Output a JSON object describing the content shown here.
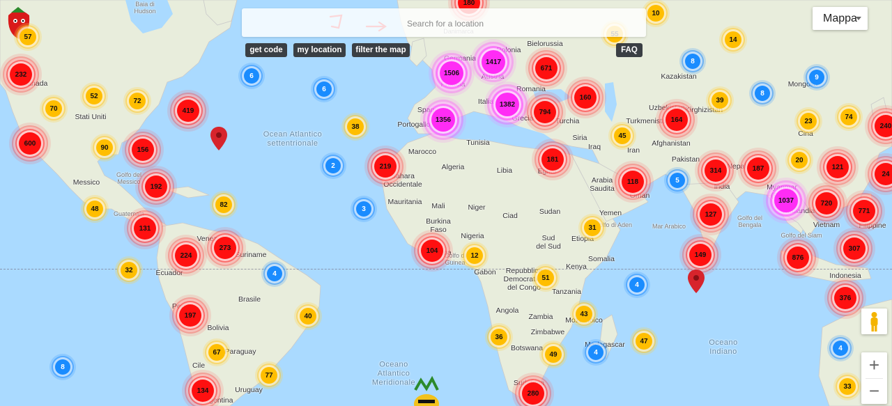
{
  "map": {
    "search_placeholder": "Search for a location",
    "map_type": "Mappa",
    "buttons": {
      "get_code": "get code",
      "my_location": "my location",
      "filter_map": "filter the map",
      "faq": "FAQ"
    },
    "labels": [
      {
        "id": "hudson",
        "text": "Baia di\nHudson",
        "cls": "faint"
      },
      {
        "id": "canada",
        "text": "Canada"
      },
      {
        "id": "stati-uniti",
        "text": "Stati Uniti"
      },
      {
        "id": "messico",
        "text": "Messico"
      },
      {
        "id": "golfo-messico",
        "text": "Golfo del\nMessico",
        "cls": "faint"
      },
      {
        "id": "guatemala",
        "text": "Guatemala",
        "cls": "faint"
      },
      {
        "id": "venezuela",
        "text": "Venezuela"
      },
      {
        "id": "suriname",
        "text": "Suriname"
      },
      {
        "id": "ecuador",
        "text": "Ecuador"
      },
      {
        "id": "peru",
        "text": "Perù"
      },
      {
        "id": "brasile",
        "text": "Brasile"
      },
      {
        "id": "bolivia",
        "text": "Bolivia"
      },
      {
        "id": "paraguay",
        "text": "Paraguay"
      },
      {
        "id": "cile",
        "text": "Cile"
      },
      {
        "id": "uruguay",
        "text": "Uruguay"
      },
      {
        "id": "argentina",
        "text": "Argentina"
      },
      {
        "id": "atlantic",
        "text": "Ocean Atlantico\nsettentrionale",
        "cls": "ocean"
      },
      {
        "id": "oceano-atlantico",
        "text": "Oceano\nAtlantico\nMeridionale",
        "cls": "ocean"
      },
      {
        "id": "oceano-indiano",
        "text": "Oceano\nIndiano",
        "cls": "ocean"
      },
      {
        "id": "danimarca",
        "text": "Danimarca",
        "cls": "faint"
      },
      {
        "id": "germania",
        "text": "Germania"
      },
      {
        "id": "polonia",
        "text": "Polonia"
      },
      {
        "id": "bielorussia",
        "text": "Bielorussia"
      },
      {
        "id": "austria",
        "text": "Austria"
      },
      {
        "id": "francia",
        "text": "Francia"
      },
      {
        "id": "romania",
        "text": "Romania"
      },
      {
        "id": "italia",
        "text": "Italia"
      },
      {
        "id": "spagna",
        "text": "Spagna"
      },
      {
        "id": "portogallo",
        "text": "Portogallo"
      },
      {
        "id": "grecia",
        "text": "Grecia"
      },
      {
        "id": "turchia",
        "text": "Turchia"
      },
      {
        "id": "kazakistan",
        "text": "Kazakistan"
      },
      {
        "id": "mongolia",
        "text": "Mongolia"
      },
      {
        "id": "uzbekistan",
        "text": "Uzbekistan"
      },
      {
        "id": "kirghizistan",
        "text": "Kirghizistan"
      },
      {
        "id": "turkmenistan",
        "text": "Turkmenistan"
      },
      {
        "id": "cina",
        "text": "Cina"
      },
      {
        "id": "siria",
        "text": "Siria"
      },
      {
        "id": "iraq",
        "text": "Iraq"
      },
      {
        "id": "iran",
        "text": "Iran"
      },
      {
        "id": "afghanistan",
        "text": "Afghanistan"
      },
      {
        "id": "pakistan",
        "text": "Pakistan"
      },
      {
        "id": "nepal",
        "text": "Nepal"
      },
      {
        "id": "india",
        "text": "India"
      },
      {
        "id": "marocco",
        "text": "Marocco"
      },
      {
        "id": "tunisia",
        "text": "Tunisia"
      },
      {
        "id": "algeria",
        "text": "Algeria"
      },
      {
        "id": "libia",
        "text": "Libia"
      },
      {
        "id": "egitto",
        "text": "Egitto"
      },
      {
        "id": "arabia",
        "text": "Arabia\nSaudita"
      },
      {
        "id": "oman",
        "text": "Oman"
      },
      {
        "id": "yemen",
        "text": "Yemen"
      },
      {
        "id": "sahara",
        "text": "Sahara\nOccidentale"
      },
      {
        "id": "mauritania",
        "text": "Mauritania"
      },
      {
        "id": "mali",
        "text": "Mali"
      },
      {
        "id": "niger",
        "text": "Niger"
      },
      {
        "id": "ciad",
        "text": "Ciad"
      },
      {
        "id": "sudan",
        "text": "Sudan"
      },
      {
        "id": "burkina",
        "text": "Burkina\nFaso"
      },
      {
        "id": "nigeria",
        "text": "Nigeria"
      },
      {
        "id": "sud-sudan",
        "text": "Sud\ndel Sud"
      },
      {
        "id": "etiopia",
        "text": "Etiopia"
      },
      {
        "id": "somalia",
        "text": "Somalia"
      },
      {
        "id": "kenya",
        "text": "Kenya"
      },
      {
        "id": "ghana",
        "text": "Ghana"
      },
      {
        "id": "golfo-guinea",
        "text": "Golfo di\nGuinea",
        "cls": "faint"
      },
      {
        "id": "gabon",
        "text": "Gabon"
      },
      {
        "id": "congo",
        "text": "Repubblica\nDemocratica\ndel Congo"
      },
      {
        "id": "tanzania",
        "text": "Tanzania"
      },
      {
        "id": "angola",
        "text": "Angola"
      },
      {
        "id": "zambia",
        "text": "Zambia"
      },
      {
        "id": "zimbabwe",
        "text": "Zimbabwe"
      },
      {
        "id": "mozambico",
        "text": "Mozambico"
      },
      {
        "id": "botswana",
        "text": "Botswana"
      },
      {
        "id": "madagascar",
        "text": "Madagascar"
      },
      {
        "id": "sudafrica",
        "text": "Sudafrica"
      },
      {
        "id": "golfo-aden",
        "text": "Golfo di Aden",
        "cls": "faint"
      },
      {
        "id": "mar-arabico",
        "text": "Mar Arabico",
        "cls": "faint"
      },
      {
        "id": "golfo-bengala",
        "text": "Golfo del\nBengala",
        "cls": "faint"
      },
      {
        "id": "golfo-siam",
        "text": "Golfo del Siam",
        "cls": "faint"
      },
      {
        "id": "myanmar",
        "text": "Myanmar\n(Birm.)"
      },
      {
        "id": "thailandia",
        "text": "Thailandia"
      },
      {
        "id": "vietnam",
        "text": "Vietnam"
      },
      {
        "id": "filippine",
        "text": "Filippine"
      },
      {
        "id": "indonesia",
        "text": "Indonesia"
      }
    ],
    "clusters": [
      {
        "v": "57",
        "c": "yel"
      },
      {
        "v": "232",
        "c": "red"
      },
      {
        "v": "52",
        "c": "yel"
      },
      {
        "v": "72",
        "c": "yel"
      },
      {
        "v": "70",
        "c": "yel"
      },
      {
        "v": "419",
        "c": "red"
      },
      {
        "v": "6",
        "c": "blu"
      },
      {
        "v": "6",
        "c": "blu"
      },
      {
        "v": "600",
        "c": "red"
      },
      {
        "v": "90",
        "c": "yel"
      },
      {
        "v": "156",
        "c": "red"
      },
      {
        "v": "38",
        "c": "yel"
      },
      {
        "v": "2",
        "c": "blu"
      },
      {
        "v": "192",
        "c": "red"
      },
      {
        "v": "48",
        "c": "yel"
      },
      {
        "v": "82",
        "c": "yel"
      },
      {
        "v": "219",
        "c": "red"
      },
      {
        "v": "3",
        "c": "blu"
      },
      {
        "v": "131",
        "c": "red"
      },
      {
        "v": "224",
        "c": "red"
      },
      {
        "v": "273",
        "c": "red"
      },
      {
        "v": "32",
        "c": "yel"
      },
      {
        "v": "4",
        "c": "blu"
      },
      {
        "v": "40",
        "c": "yel"
      },
      {
        "v": "197",
        "c": "red"
      },
      {
        "v": "8",
        "c": "blu"
      },
      {
        "v": "67",
        "c": "yel"
      },
      {
        "v": "77",
        "c": "yel"
      },
      {
        "v": "134",
        "c": "red"
      },
      {
        "v": "180",
        "c": "red"
      },
      {
        "v": "10",
        "c": "yel"
      },
      {
        "v": "55",
        "c": "yel"
      },
      {
        "v": "14",
        "c": "yel"
      },
      {
        "v": "1506",
        "c": "mag"
      },
      {
        "v": "1417",
        "c": "mag"
      },
      {
        "v": "671",
        "c": "red"
      },
      {
        "v": "8",
        "c": "blu"
      },
      {
        "v": "9",
        "c": "blu"
      },
      {
        "v": "8",
        "c": "blu"
      },
      {
        "v": "1382",
        "c": "mag"
      },
      {
        "v": "160",
        "c": "red"
      },
      {
        "v": "39",
        "c": "yel"
      },
      {
        "v": "1356",
        "c": "mag"
      },
      {
        "v": "794",
        "c": "red"
      },
      {
        "v": "164",
        "c": "red"
      },
      {
        "v": "23",
        "c": "yel"
      },
      {
        "v": "74",
        "c": "yel"
      },
      {
        "v": "45",
        "c": "yel"
      },
      {
        "v": "181",
        "c": "red"
      },
      {
        "v": "118",
        "c": "red"
      },
      {
        "v": "5",
        "c": "blu"
      },
      {
        "v": "314",
        "c": "red"
      },
      {
        "v": "187",
        "c": "red"
      },
      {
        "v": "20",
        "c": "yel"
      },
      {
        "v": "121",
        "c": "red"
      },
      {
        "v": "1037",
        "c": "mag"
      },
      {
        "v": "720",
        "c": "red"
      },
      {
        "v": "771",
        "c": "red"
      },
      {
        "v": "127",
        "c": "red"
      },
      {
        "v": "31",
        "c": "yel"
      },
      {
        "v": "104",
        "c": "red"
      },
      {
        "v": "12",
        "c": "yel"
      },
      {
        "v": "149",
        "c": "red"
      },
      {
        "v": "876",
        "c": "red"
      },
      {
        "v": "307",
        "c": "red"
      },
      {
        "v": "51",
        "c": "yel"
      },
      {
        "v": "4",
        "c": "blu"
      },
      {
        "v": "376",
        "c": "red"
      },
      {
        "v": "43",
        "c": "yel"
      },
      {
        "v": "36",
        "c": "yel"
      },
      {
        "v": "49",
        "c": "yel"
      },
      {
        "v": "4",
        "c": "blu"
      },
      {
        "v": "47",
        "c": "yel"
      },
      {
        "v": "4",
        "c": "blu"
      },
      {
        "v": "280",
        "c": "red"
      },
      {
        "v": "33",
        "c": "yel"
      },
      {
        "v": "240",
        "c": "red"
      },
      {
        "v": "24",
        "c": "red"
      }
    ],
    "colors": {
      "red": "#ff1010",
      "magenta": "#ff2cf5",
      "yellow": "#ffbe00",
      "blue": "#1a8cff",
      "water": "#aadaff",
      "land": "#e8eddc"
    }
  }
}
